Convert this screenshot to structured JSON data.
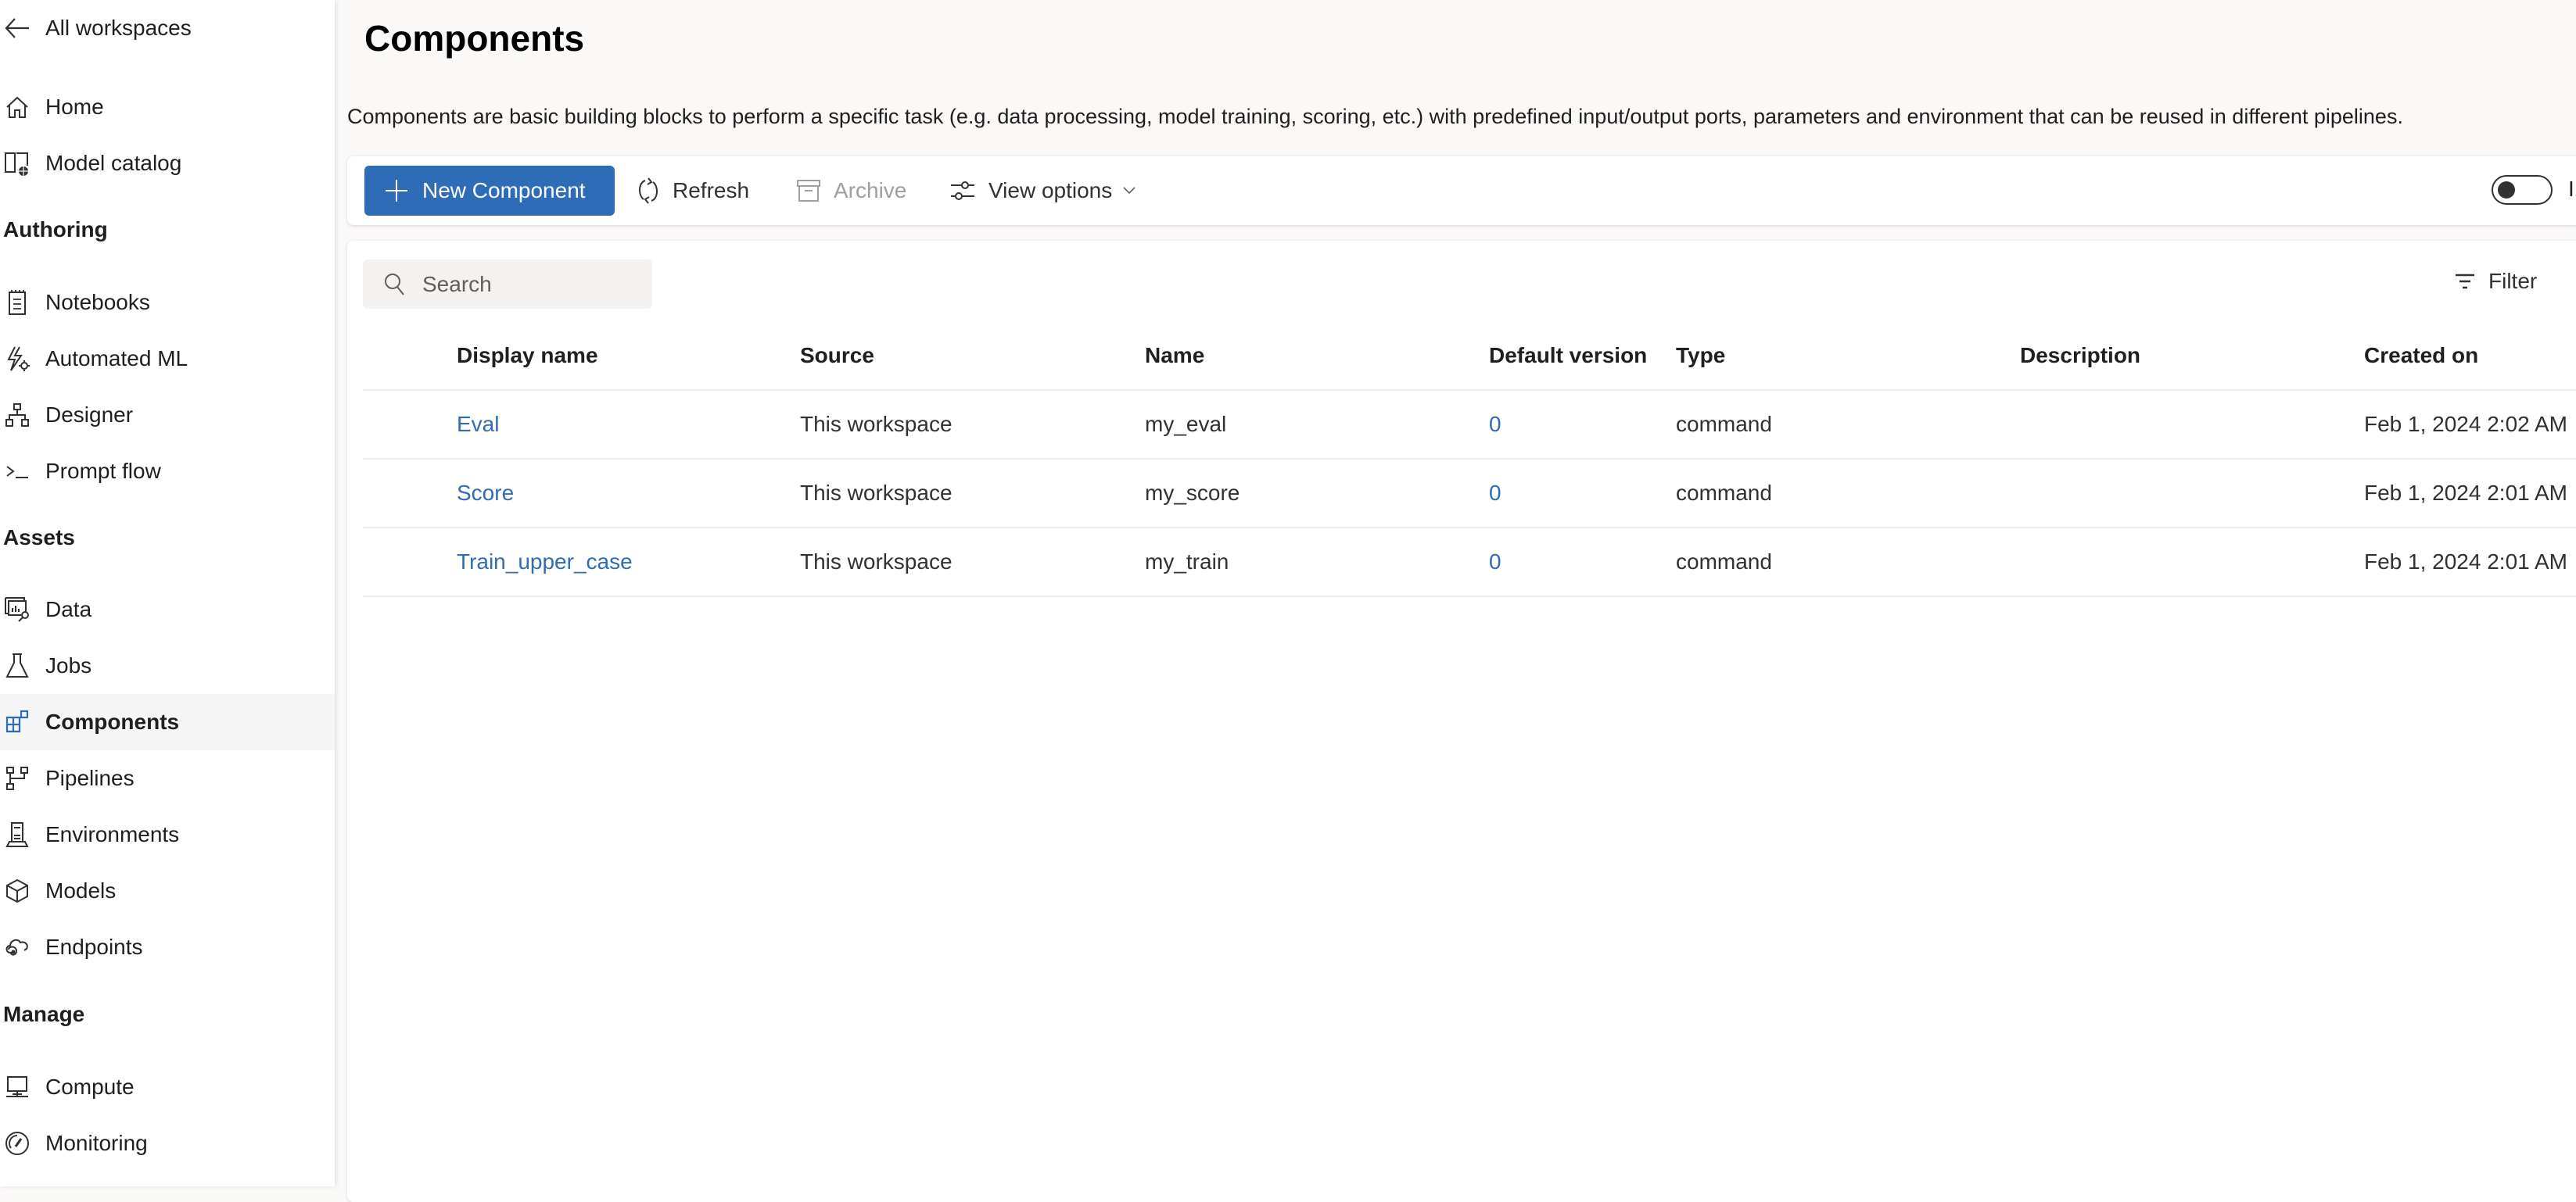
{
  "sidebar": {
    "back_label": "All workspaces",
    "items_top": [
      {
        "label": "Home",
        "icon": "home-icon"
      },
      {
        "label": "Model catalog",
        "icon": "model-catalog-icon"
      }
    ],
    "sections": [
      {
        "heading": "Authoring",
        "items": [
          {
            "label": "Notebooks",
            "icon": "notebook-icon"
          },
          {
            "label": "Automated ML",
            "icon": "automated-ml-icon"
          },
          {
            "label": "Designer",
            "icon": "designer-icon"
          },
          {
            "label": "Prompt flow",
            "icon": "prompt-flow-icon"
          }
        ]
      },
      {
        "heading": "Assets",
        "items": [
          {
            "label": "Data",
            "icon": "data-icon"
          },
          {
            "label": "Jobs",
            "icon": "flask-icon"
          },
          {
            "label": "Components",
            "icon": "components-icon",
            "active": true
          },
          {
            "label": "Pipelines",
            "icon": "pipelines-icon"
          },
          {
            "label": "Environments",
            "icon": "environments-icon"
          },
          {
            "label": "Models",
            "icon": "cube-icon"
          },
          {
            "label": "Endpoints",
            "icon": "endpoints-icon"
          }
        ]
      },
      {
        "heading": "Manage",
        "items": [
          {
            "label": "Compute",
            "icon": "compute-icon"
          },
          {
            "label": "Monitoring",
            "icon": "gauge-icon"
          }
        ]
      }
    ]
  },
  "page": {
    "title": "Components",
    "description": "Components are basic building blocks to perform a specific task (e.g. data processing, model training, scoring, etc.) with predefined input/output ports, parameters and environment that can be reused in different pipelines."
  },
  "toolbar": {
    "new_label": "New Component",
    "refresh_label": "Refresh",
    "archive_label": "Archive",
    "view_options_label": "View options",
    "toggle_label": "I",
    "toggle_on": false
  },
  "list": {
    "search_placeholder": "Search",
    "search_value": "",
    "filter_label": "Filter",
    "columns": [
      "Display name",
      "Source",
      "Name",
      "Default version",
      "Type",
      "Description",
      "Created on"
    ],
    "rows": [
      {
        "display_name": "Eval",
        "source": "This workspace",
        "name": "my_eval",
        "default_version": "0",
        "type": "command",
        "description": "",
        "created_on": "Feb 1, 2024 2:02 AM"
      },
      {
        "display_name": "Score",
        "source": "This workspace",
        "name": "my_score",
        "default_version": "0",
        "type": "command",
        "description": "",
        "created_on": "Feb 1, 2024 2:01 AM"
      },
      {
        "display_name": "Train_upper_case",
        "source": "This workspace",
        "name": "my_train",
        "default_version": "0",
        "type": "command",
        "description": "",
        "created_on": "Feb 1, 2024 2:01 AM"
      }
    ]
  },
  "colors": {
    "accent": "#2f6cb8",
    "active_nav_bg": "#f5f5f5",
    "page_bg": "#faf9f8"
  }
}
